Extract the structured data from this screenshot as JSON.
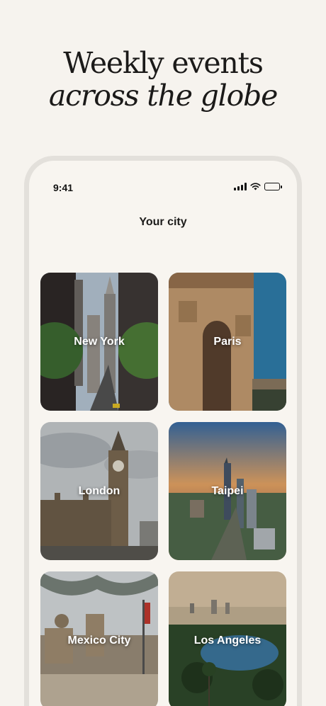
{
  "headline": {
    "line1": "Weekly events",
    "line2": "across the globe"
  },
  "status_bar": {
    "time": "9:41",
    "icons": [
      "cellular-signal-icon",
      "wifi-icon",
      "battery-icon"
    ]
  },
  "screen": {
    "title": "Your city"
  },
  "cities": [
    {
      "label": "New York"
    },
    {
      "label": "Paris"
    },
    {
      "label": "London"
    },
    {
      "label": "Taipei"
    },
    {
      "label": "Mexico City"
    },
    {
      "label": "Los Angeles"
    }
  ],
  "colors": {
    "background": "#f6f3ee",
    "phone_frame": "#e3e0db",
    "text": "#1b1a19"
  }
}
